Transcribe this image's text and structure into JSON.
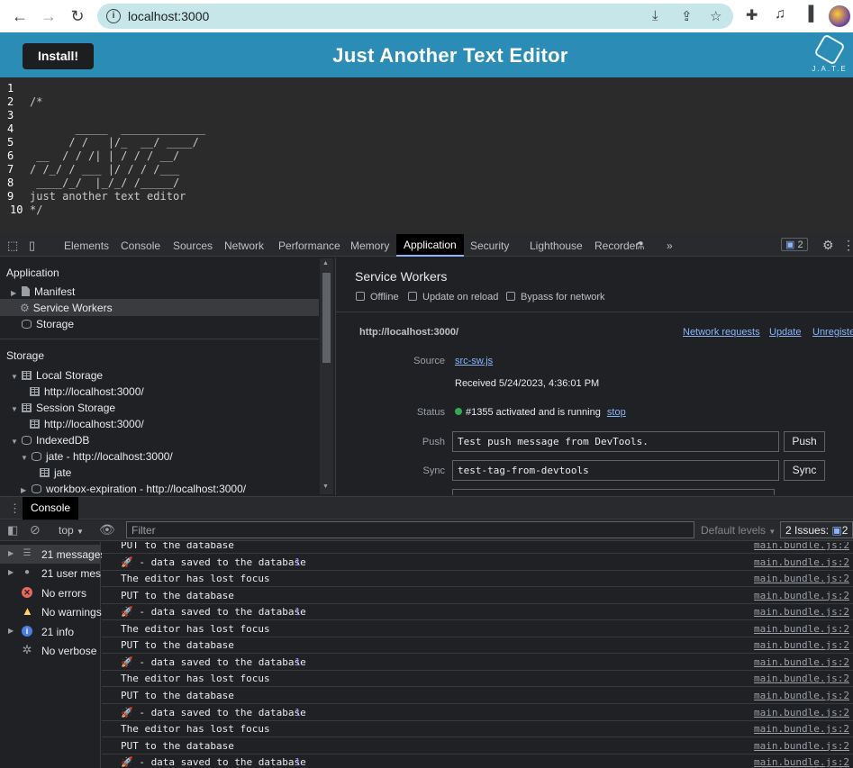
{
  "browser": {
    "url": "localhost:3000"
  },
  "app": {
    "install_label": "Install!",
    "title": "Just Another Text Editor",
    "logo_text": "J.A.T.E"
  },
  "editor": {
    "line_numbers": [
      "1",
      "2",
      "3",
      "4",
      "5",
      "6",
      "7",
      "8",
      "9",
      "10"
    ],
    "lines": [
      "",
      "/*",
      "",
      "       _____  _____________",
      "      / /   |/_  __/ ____/",
      " __  / / /| | / / / __/",
      "/ /_/ / ___ |/ / / /___",
      " ____/_/  |_/_/ /_____/",
      "just another text editor",
      "*/"
    ]
  },
  "devtools": {
    "tabs": [
      "Elements",
      "Console",
      "Sources",
      "Network",
      "Performance",
      "Memory",
      "Application",
      "Security",
      "Lighthouse",
      "Recorder"
    ],
    "issues_count": "2",
    "left": {
      "application_header": "Application",
      "manifest": "Manifest",
      "service_workers": "Service Workers",
      "storage_item": "Storage",
      "storage_header": "Storage",
      "local_storage": "Local Storage",
      "local_storage_origin": "http://localhost:3000/",
      "session_storage": "Session Storage",
      "session_storage_origin": "http://localhost:3000/",
      "indexeddb": "IndexedDB",
      "jate_db": "jate - http://localhost:3000/",
      "jate_store": "jate",
      "workbox_db": "workbox-expiration - http://localhost:3000/"
    },
    "right": {
      "title": "Service Workers",
      "offline": "Offline",
      "update_on_reload": "Update on reload",
      "bypass": "Bypass for network",
      "origin": "http://localhost:3000/",
      "network_requests": "Network requests",
      "update": "Update",
      "unregister": "Unregister",
      "source_label": "Source",
      "source_link": "src-sw.js",
      "received": "Received 5/24/2023, 4:36:01 PM",
      "status_label": "Status",
      "status_text": "#1355 activated and is running",
      "stop": "stop",
      "push_label": "Push",
      "push_value": "Test push message from DevTools.",
      "push_button": "Push",
      "sync_label": "Sync",
      "sync_value": "test-tag-from-devtools",
      "sync_button": "Sync"
    },
    "drawer": {
      "tab": "Console",
      "context": "top",
      "filter_placeholder": "Filter",
      "levels": "Default levels",
      "issues": "2 Issues:",
      "issues_count": "2"
    },
    "console_side": {
      "messages": "21 messages",
      "user_messages": "21 user mes…",
      "errors": "No errors",
      "warnings": "No warnings",
      "info": "21 info",
      "verbose": "No verbose"
    },
    "logs": [
      {
        "msg": "PUT to the database",
        "count": "",
        "src": "main.bundle.js:2"
      },
      {
        "msg": "🚀 - data saved to the database",
        "count": "1",
        "src": "main.bundle.js:2"
      },
      {
        "msg": "The editor has lost focus",
        "count": "",
        "src": "main.bundle.js:2"
      },
      {
        "msg": "PUT to the database",
        "count": "",
        "src": "main.bundle.js:2"
      },
      {
        "msg": "🚀 - data saved to the database",
        "count": "1",
        "src": "main.bundle.js:2"
      },
      {
        "msg": "The editor has lost focus",
        "count": "",
        "src": "main.bundle.js:2"
      },
      {
        "msg": "PUT to the database",
        "count": "",
        "src": "main.bundle.js:2"
      },
      {
        "msg": "🚀 - data saved to the database",
        "count": "1",
        "src": "main.bundle.js:2"
      },
      {
        "msg": "The editor has lost focus",
        "count": "",
        "src": "main.bundle.js:2"
      },
      {
        "msg": "PUT to the database",
        "count": "",
        "src": "main.bundle.js:2"
      },
      {
        "msg": "🚀 - data saved to the database",
        "count": "1",
        "src": "main.bundle.js:2"
      },
      {
        "msg": "The editor has lost focus",
        "count": "",
        "src": "main.bundle.js:2"
      },
      {
        "msg": "PUT to the database",
        "count": "",
        "src": "main.bundle.js:2"
      },
      {
        "msg": "🚀 - data saved to the database",
        "count": "1",
        "src": "main.bundle.js:2"
      }
    ]
  }
}
